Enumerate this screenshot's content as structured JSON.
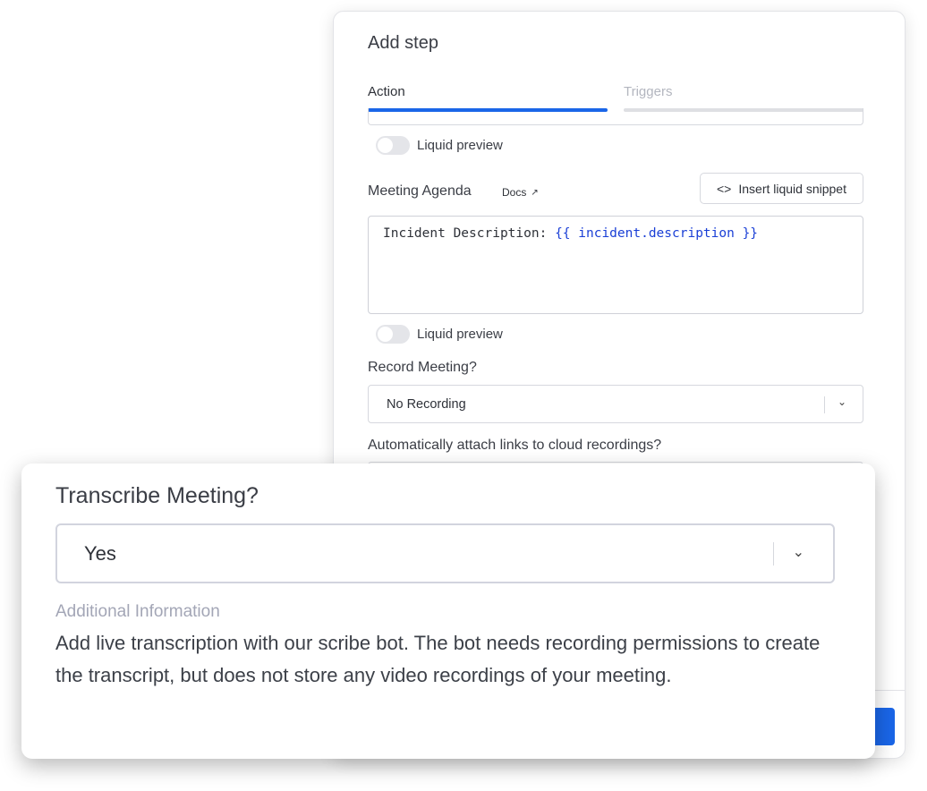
{
  "panel": {
    "title": "Add step",
    "tabs": [
      {
        "label": "Action",
        "active": true
      },
      {
        "label": "Triggers",
        "active": false
      }
    ],
    "liquid_preview_label": "Liquid preview",
    "meeting_agenda": {
      "label": "Meeting Agenda",
      "docs_label": "Docs",
      "snippet_button": "Insert liquid snippet",
      "value_prefix": "Incident Description: ",
      "value_liquid": "{{ incident.description }}"
    },
    "liquid_preview_label_2": "Liquid preview",
    "record_meeting": {
      "label": "Record Meeting?",
      "value": "No Recording"
    },
    "attach_links": {
      "label": "Automatically attach links to cloud recordings?"
    },
    "accent": "#1a66e8"
  },
  "card": {
    "title": "Transcribe Meeting?",
    "value": "Yes",
    "additional_label": "Additional Information",
    "description": "Add live transcription with our scribe bot. The bot needs recording permissions to create the transcript, but does not store any video recordings of your meeting."
  }
}
